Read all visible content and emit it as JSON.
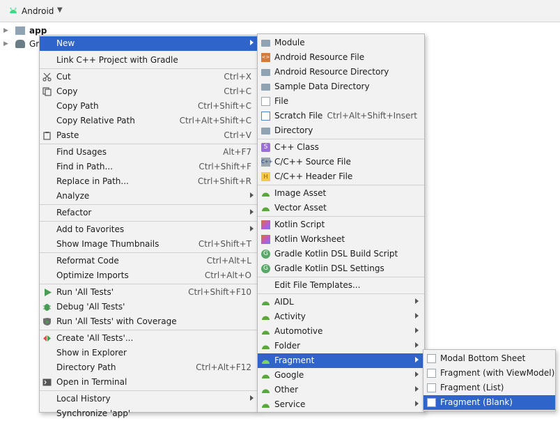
{
  "toolbar": {
    "view_label": "Android"
  },
  "tree": {
    "app_label": "app",
    "gradle_label": "Gr"
  },
  "main_menu": {
    "items": {
      "new": "New",
      "link_cpp": "Link C++ Project with Gradle",
      "cut": "Cut",
      "cut_sc": "Ctrl+X",
      "copy": "Copy",
      "copy_sc": "Ctrl+C",
      "copy_path": "Copy Path",
      "copy_path_sc": "Ctrl+Shift+C",
      "copy_rel": "Copy Relative Path",
      "copy_rel_sc": "Ctrl+Alt+Shift+C",
      "paste": "Paste",
      "paste_sc": "Ctrl+V",
      "find_usages": "Find Usages",
      "find_usages_sc": "Alt+F7",
      "find_in_path": "Find in Path...",
      "find_in_path_sc": "Ctrl+Shift+F",
      "replace_in_path": "Replace in Path...",
      "replace_in_path_sc": "Ctrl+Shift+R",
      "analyze": "Analyze",
      "refactor": "Refactor",
      "add_favorites": "Add to Favorites",
      "show_thumbs": "Show Image Thumbnails",
      "show_thumbs_sc": "Ctrl+Shift+T",
      "reformat": "Reformat Code",
      "reformat_sc": "Ctrl+Alt+L",
      "optimize": "Optimize Imports",
      "optimize_sc": "Ctrl+Alt+O",
      "run": "Run 'All Tests'",
      "run_sc": "Ctrl+Shift+F10",
      "debug": "Debug 'All Tests'",
      "coverage": "Run 'All Tests' with Coverage",
      "create": "Create 'All Tests'...",
      "show_explorer": "Show in Explorer",
      "dir_path": "Directory Path",
      "dir_path_sc": "Ctrl+Alt+F12",
      "open_terminal": "Open in Terminal",
      "local_history": "Local History",
      "sync": "Synchronize 'app'"
    }
  },
  "new_menu": {
    "module": "Module",
    "res_file": "Android Resource File",
    "res_dir": "Android Resource Directory",
    "sample_dir": "Sample Data Directory",
    "file": "File",
    "scratch": "Scratch File",
    "scratch_sc": "Ctrl+Alt+Shift+Insert",
    "directory": "Directory",
    "cpp_class": "C++ Class",
    "cpp_source": "C/C++ Source File",
    "cpp_header": "C/C++ Header File",
    "image_asset": "Image Asset",
    "vector_asset": "Vector Asset",
    "kotlin_script": "Kotlin Script",
    "kotlin_ws": "Kotlin Worksheet",
    "gradle_build": "Gradle Kotlin DSL Build Script",
    "gradle_settings": "Gradle Kotlin DSL Settings",
    "edit_templates": "Edit File Templates...",
    "aidl": "AIDL",
    "activity": "Activity",
    "automotive": "Automotive",
    "folder": "Folder",
    "fragment": "Fragment",
    "google": "Google",
    "other": "Other",
    "service": "Service"
  },
  "fragment_menu": {
    "modal": "Modal Bottom Sheet",
    "viewmodel": "Fragment (with ViewModel)",
    "list": "Fragment (List)",
    "blank": "Fragment (Blank)"
  }
}
